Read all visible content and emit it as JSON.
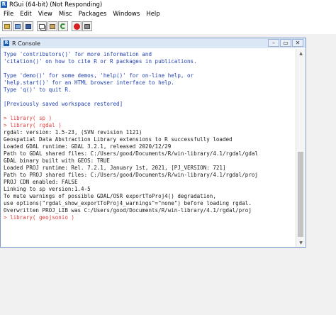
{
  "window": {
    "title": "RGui (64-bit) (Not Responding)"
  },
  "menu": {
    "items": [
      "File",
      "Edit",
      "View",
      "Misc",
      "Packages",
      "Windows",
      "Help"
    ]
  },
  "toolbar": {
    "buttons": [
      "open-script-icon",
      "load-workspace-icon",
      "save-workspace-icon",
      "copy-icon",
      "paste-icon",
      "copy-paste-icon",
      "stop-icon",
      "print-icon"
    ]
  },
  "console": {
    "title": "R Console",
    "minimize": "–",
    "restore": "▭",
    "close": "✕",
    "lines": [
      {
        "text": "Type 'contributors()' for more information and",
        "color": "blue"
      },
      {
        "text": "'citation()' on how to cite R or R packages in publications.",
        "color": "blue"
      },
      {
        "text": "",
        "color": "blue"
      },
      {
        "text": "Type 'demo()' for some demos, 'help()' for on-line help, or",
        "color": "blue"
      },
      {
        "text": "'help.start()' for an HTML browser interface to help.",
        "color": "blue"
      },
      {
        "text": "Type 'q()' to quit R.",
        "color": "blue"
      },
      {
        "text": "",
        "color": "blue"
      },
      {
        "text": "[Previously saved workspace restored]",
        "color": "blue"
      },
      {
        "text": "",
        "color": "blue"
      },
      {
        "text": "> library( sp )",
        "color": "red"
      },
      {
        "text": "> library( rgdal )",
        "color": "red"
      },
      {
        "text": "rgdal: version: 1.5-23, (SVN revision 1121)",
        "color": "black"
      },
      {
        "text": "Geospatial Data Abstraction Library extensions to R successfully loaded",
        "color": "black"
      },
      {
        "text": "Loaded GDAL runtime: GDAL 3.2.1, released 2020/12/29",
        "color": "black"
      },
      {
        "text": "Path to GDAL shared files: C:/Users/good/Documents/R/win-library/4.1/rgdal/gdal",
        "color": "black"
      },
      {
        "text": "GDAL binary built with GEOS: TRUE",
        "color": "black"
      },
      {
        "text": "Loaded PROJ runtime: Rel. 7.2.1, January 1st, 2021, [PJ_VERSION: 721]",
        "color": "black"
      },
      {
        "text": "Path to PROJ shared files: C:/Users/good/Documents/R/win-library/4.1/rgdal/proj",
        "color": "black"
      },
      {
        "text": "PROJ CDN enabled: FALSE",
        "color": "black"
      },
      {
        "text": "Linking to sp version:1.4-5",
        "color": "black"
      },
      {
        "text": "To mute warnings of possible GDAL/OSR exportToProj4() degradation,",
        "color": "black"
      },
      {
        "text": "use options(\"rgdal_show_exportToProj4_warnings\"=\"none\") before loading rgdal.",
        "color": "black"
      },
      {
        "text": "Overwritten PROJ_LIB was C:/Users/good/Documents/R/win-library/4.1/rgdal/proj",
        "color": "black"
      },
      {
        "text": "> library( geojsonio )",
        "color": "red"
      }
    ]
  }
}
